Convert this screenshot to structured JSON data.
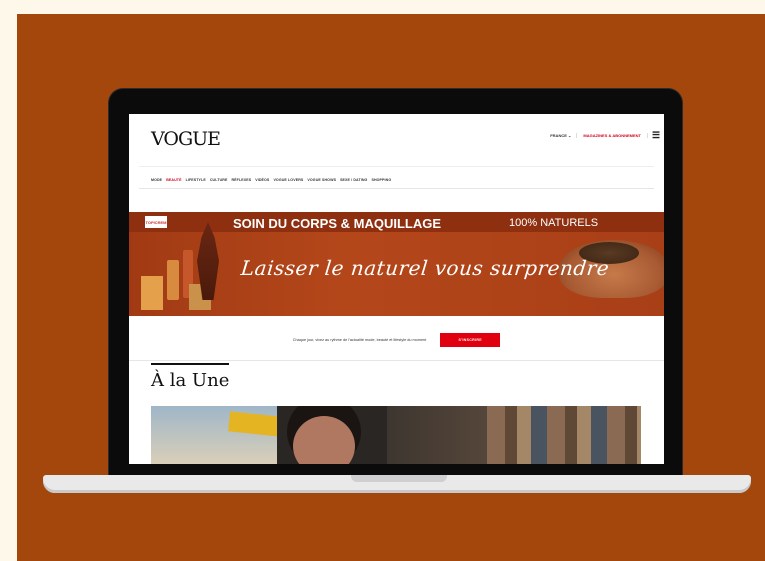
{
  "site": {
    "logo": "VOGUE",
    "region": "FRANCE ⌄",
    "subscribe": "MAGAZINES & ABONNEMENT",
    "menu_icon": "hamburger-icon"
  },
  "nav": {
    "items": [
      "MODE",
      "BEAUTÉ",
      "LIFESTYLE",
      "CULTURE",
      "RÉFLEXES",
      "VIDÉOS",
      "VOGUE LOVERS",
      "VOGUE SHOWS",
      "SEXE / DATING",
      "SHOPPING"
    ],
    "active": "BEAUTÉ"
  },
  "banner": {
    "brand": "TOPICREM",
    "title": "SOIN DU CORPS & MAQUILLAGE",
    "natural": "100% NATURELS",
    "script": "Laisser le naturel vous surprendre"
  },
  "newsletter": {
    "tagline": "Chaque jour, vivez au rythme de l'actualité mode, beauté et lifestyle du moment",
    "button": "S'INSCRIRE"
  },
  "section": {
    "title": "À la Une"
  },
  "colors": {
    "background": "#a4470c",
    "accent": "#d0021b"
  }
}
